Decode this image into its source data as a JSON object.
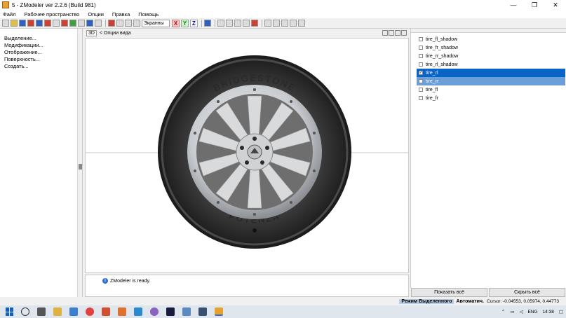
{
  "window": {
    "title": "5 - ZModeler ver 2.2.6 (Build 981)",
    "controls": [
      "—",
      "❐",
      "✕"
    ]
  },
  "menu": [
    "Файл",
    "Рабочее пространство",
    "Опции",
    "Правка",
    "Помощь"
  ],
  "toolbar": {
    "view_mode": "Экранны",
    "axes": [
      "X",
      "Y",
      "Z"
    ]
  },
  "left_panel": {
    "items": [
      "Выделение...",
      "Модификации...",
      "Отображение...",
      "Поверхность...",
      "Создать..."
    ]
  },
  "viewport": {
    "mode_badge": "3D",
    "options_label": "< Опции вида",
    "tire_text_top": "BRIDGESTONE",
    "tire_text_bottom": "POTENZA"
  },
  "log": {
    "message": "ZModeler is ready."
  },
  "objects": {
    "items": [
      {
        "label": "tire_fl_shadow",
        "checked": false,
        "state": "normal"
      },
      {
        "label": "tire_fr_shadow",
        "checked": false,
        "state": "normal"
      },
      {
        "label": "tire_rr_shadow",
        "checked": false,
        "state": "normal"
      },
      {
        "label": "tire_rl_shadow",
        "checked": false,
        "state": "normal"
      },
      {
        "label": "tire_rl",
        "checked": true,
        "state": "selected"
      },
      {
        "label": "tire_rr",
        "checked": false,
        "state": "highlighted"
      },
      {
        "label": "tire_fl",
        "checked": false,
        "state": "normal"
      },
      {
        "label": "tire_fr",
        "checked": false,
        "state": "normal"
      }
    ],
    "show_all": "Показать всё",
    "hide_all": "Скрыть всё"
  },
  "status": {
    "mode": "Режим Выделенного",
    "auto": "Автоматич.",
    "cursor": "Cursor: -0.04553, 0.05974, 0.44773"
  },
  "taskbar": {
    "lang": "ENG",
    "time": "14:38"
  },
  "colors": {
    "selection": "#0a64c8",
    "highlight": "#6a9fd8",
    "mode_bg": "#b8cce4"
  }
}
